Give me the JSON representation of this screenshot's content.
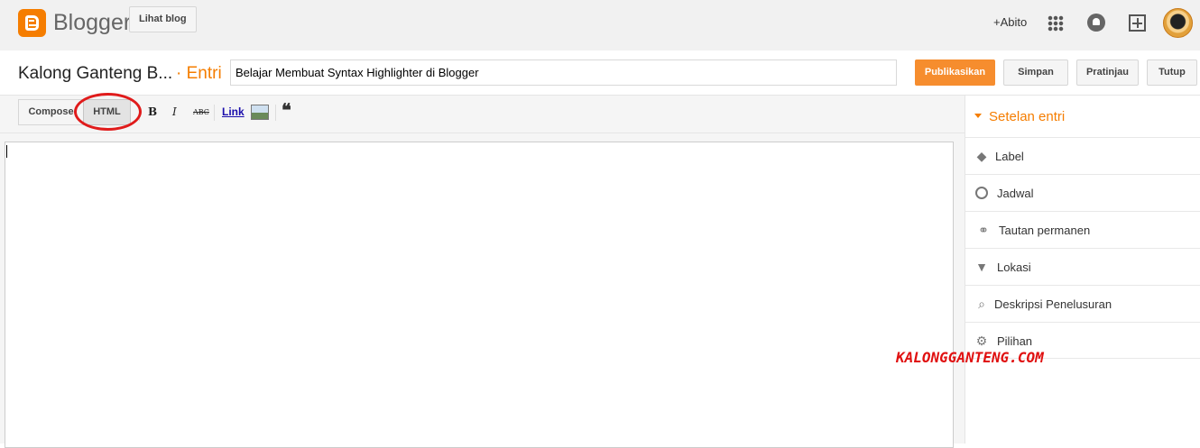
{
  "header": {
    "brand": "Blogger",
    "view_blog_label": "Lihat blog",
    "user_label": "+Abito"
  },
  "post": {
    "blog_name": "Kalong Ganteng B...",
    "section": "· Entri",
    "title_value": "Belajar Membuat Syntax Highlighter di Blogger",
    "publish_label": "Publikasikan",
    "save_label": "Simpan",
    "preview_label": "Pratinjau",
    "close_label": "Tutup"
  },
  "toolbar": {
    "compose_label": "Compose",
    "html_label": "HTML",
    "bold": "B",
    "italic": "I",
    "strike": "ABC",
    "link_label": "Link",
    "quote": "❝"
  },
  "sidebar": {
    "heading": "Setelan entri",
    "items": [
      {
        "label": "Label",
        "icon": "tag-icon"
      },
      {
        "label": "Jadwal",
        "icon": "clock-icon"
      },
      {
        "label": "Tautan permanen",
        "icon": "link-icon"
      },
      {
        "label": "Lokasi",
        "icon": "pin-icon"
      },
      {
        "label": "Deskripsi Penelusuran",
        "icon": "search-icon"
      },
      {
        "label": "Pilihan",
        "icon": "gear-icon"
      }
    ]
  },
  "watermark": "KALONGGANTENG.COM",
  "colors": {
    "accent": "#f57d00",
    "primary_button": "#f68d2e",
    "highlight": "#e01b1b"
  }
}
